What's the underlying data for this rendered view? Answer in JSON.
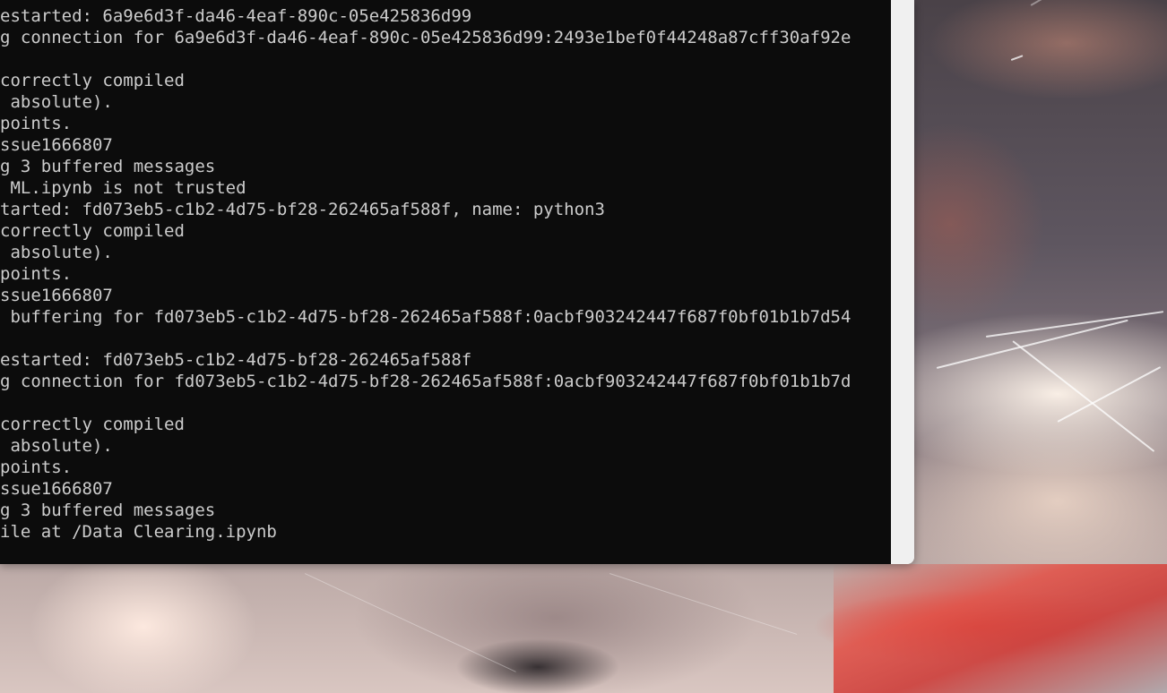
{
  "console": {
    "lines": [
      "estarted: 6a9e6d3f-da46-4eaf-890c-05e425836d99",
      "g connection for 6a9e6d3f-da46-4eaf-890c-05e425836d99:2493e1bef0f44248a87cff30af92e",
      "",
      "correctly compiled",
      " absolute).",
      "points.",
      "ssue1666807",
      "g 3 buffered messages",
      " ML.ipynb is not trusted",
      "tarted: fd073eb5-c1b2-4d75-bf28-262465af588f, name: python3",
      "correctly compiled",
      " absolute).",
      "points.",
      "ssue1666807",
      " buffering for fd073eb5-c1b2-4d75-bf28-262465af588f:0acbf903242447f687f0bf01b1b7d54",
      "",
      "estarted: fd073eb5-c1b2-4d75-bf28-262465af588f",
      "g connection for fd073eb5-c1b2-4d75-bf28-262465af588f:0acbf903242447f687f0bf01b1b7d",
      "",
      "correctly compiled",
      " absolute).",
      "points.",
      "ssue1666807",
      "g 3 buffered messages",
      "ile at /Data Clearing.ipynb"
    ]
  }
}
